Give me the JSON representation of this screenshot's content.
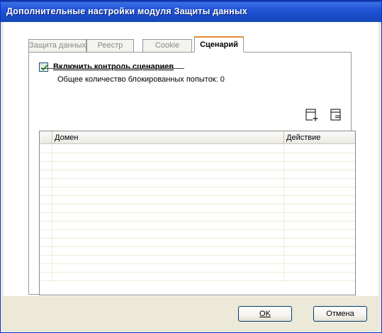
{
  "window": {
    "title": "Дополнительные настройки модуля Защиты данных"
  },
  "tabs": [
    {
      "label": "Защита данных",
      "active": false
    },
    {
      "label": "Реестр",
      "active": false
    },
    {
      "label": "Cookie",
      "active": false
    },
    {
      "label": "Сценарий",
      "active": true
    }
  ],
  "script_control": {
    "checkbox_label": "Включить контроль сценариев",
    "checked": true,
    "blocked_attempts_text": "Общее количество блокированных попыток: 0"
  },
  "toolbar": {
    "add_icon": "add-rule-icon",
    "edit_icon": "edit-rule-icon"
  },
  "table": {
    "columns": [
      "",
      "Домен",
      "Действие"
    ],
    "rows": []
  },
  "buttons": {
    "ok_label": "OK",
    "cancel_label": "Отмена"
  },
  "colors": {
    "title_bar": "#2155d6",
    "active_tab_accent": "#e68b2c",
    "dialog_face": "#ece9d8"
  }
}
